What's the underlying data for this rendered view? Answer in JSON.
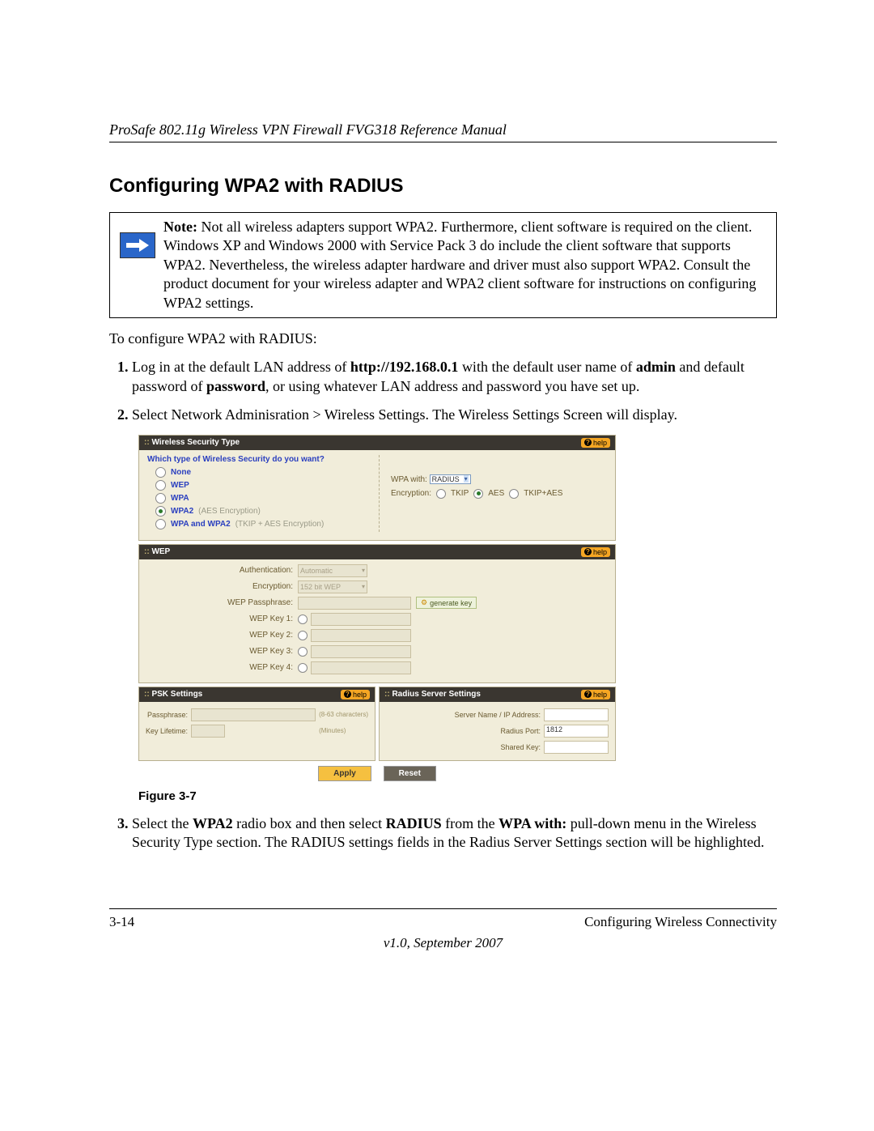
{
  "doc": {
    "running_header": "ProSafe 802.11g Wireless VPN Firewall FVG318 Reference Manual",
    "section_title": "Configuring WPA2 with RADIUS",
    "note_label": "Note:",
    "note_text": " Not all wireless adapters support WPA2. Furthermore, client software is required on the client. Windows XP and Windows 2000 with Service Pack 3 do include the client software that supports WPA2. Nevertheless, the wireless adapter hardware and driver must also support WPA2. Consult the product document for your wireless adapter and WPA2 client software for instructions on configuring WPA2 settings.",
    "intro": "To configure WPA2 with RADIUS:",
    "step1_a": "Log in at the default LAN address of ",
    "step1_b": "http://192.168.0.1",
    "step1_c": " with the default user name of ",
    "step1_d": "admin",
    "step1_e": " and default password of ",
    "step1_f": "password",
    "step1_g": ", or using whatever LAN address and password you have set up.",
    "step2": "Select Network Adminisration > Wireless Settings. The Wireless Settings Screen will display.",
    "fig_caption": "Figure 3-7",
    "step3_a": "Select the ",
    "step3_b": "WPA2",
    "step3_c": " radio box and then select ",
    "step3_d": "RADIUS",
    "step3_e": " from the ",
    "step3_f": "WPA with:",
    "step3_g": " pull-down menu in the Wireless Security Type section. The RADIUS settings fields in the Radius Server Settings section will be highlighted.",
    "page_num": "3-14",
    "footer_right": "Configuring Wireless Connectivity",
    "version": "v1.0, September 2007"
  },
  "ui": {
    "help": "help",
    "sec_type": {
      "title": "Wireless Security Type",
      "question": "Which type of Wireless Security do you want?",
      "opts": {
        "none": "None",
        "wep": "WEP",
        "wpa": "WPA",
        "wpa2": "WPA2",
        "wpa2_note": "(AES Encryption)",
        "both": "WPA and WPA2",
        "both_note": "(TKIP + AES Encryption)"
      },
      "wpa_with": "WPA with:",
      "wpa_with_val": "RADIUS",
      "enc_label": "Encryption:",
      "enc_tkip": "TKIP",
      "enc_aes": "AES",
      "enc_both": "TKIP+AES"
    },
    "wep": {
      "title": "WEP",
      "auth": "Authentication:",
      "auth_val": "Automatic",
      "enc": "Encryption:",
      "enc_val": "152 bit WEP",
      "pass": "WEP Passphrase:",
      "gen": "generate key",
      "k1": "WEP Key 1:",
      "k2": "WEP Key 2:",
      "k3": "WEP Key 3:",
      "k4": "WEP Key 4:"
    },
    "psk": {
      "title": "PSK Settings",
      "pass": "Passphrase:",
      "pass_hint": "(8-63 characters)",
      "life": "Key Lifetime:",
      "life_hint": "(Minutes)",
      "life_val": ""
    },
    "radius": {
      "title": "Radius Server Settings",
      "server": "Server Name / IP Address:",
      "port": "Radius Port:",
      "port_val": "1812",
      "shared": "Shared Key:"
    },
    "apply": "Apply",
    "reset": "Reset"
  }
}
